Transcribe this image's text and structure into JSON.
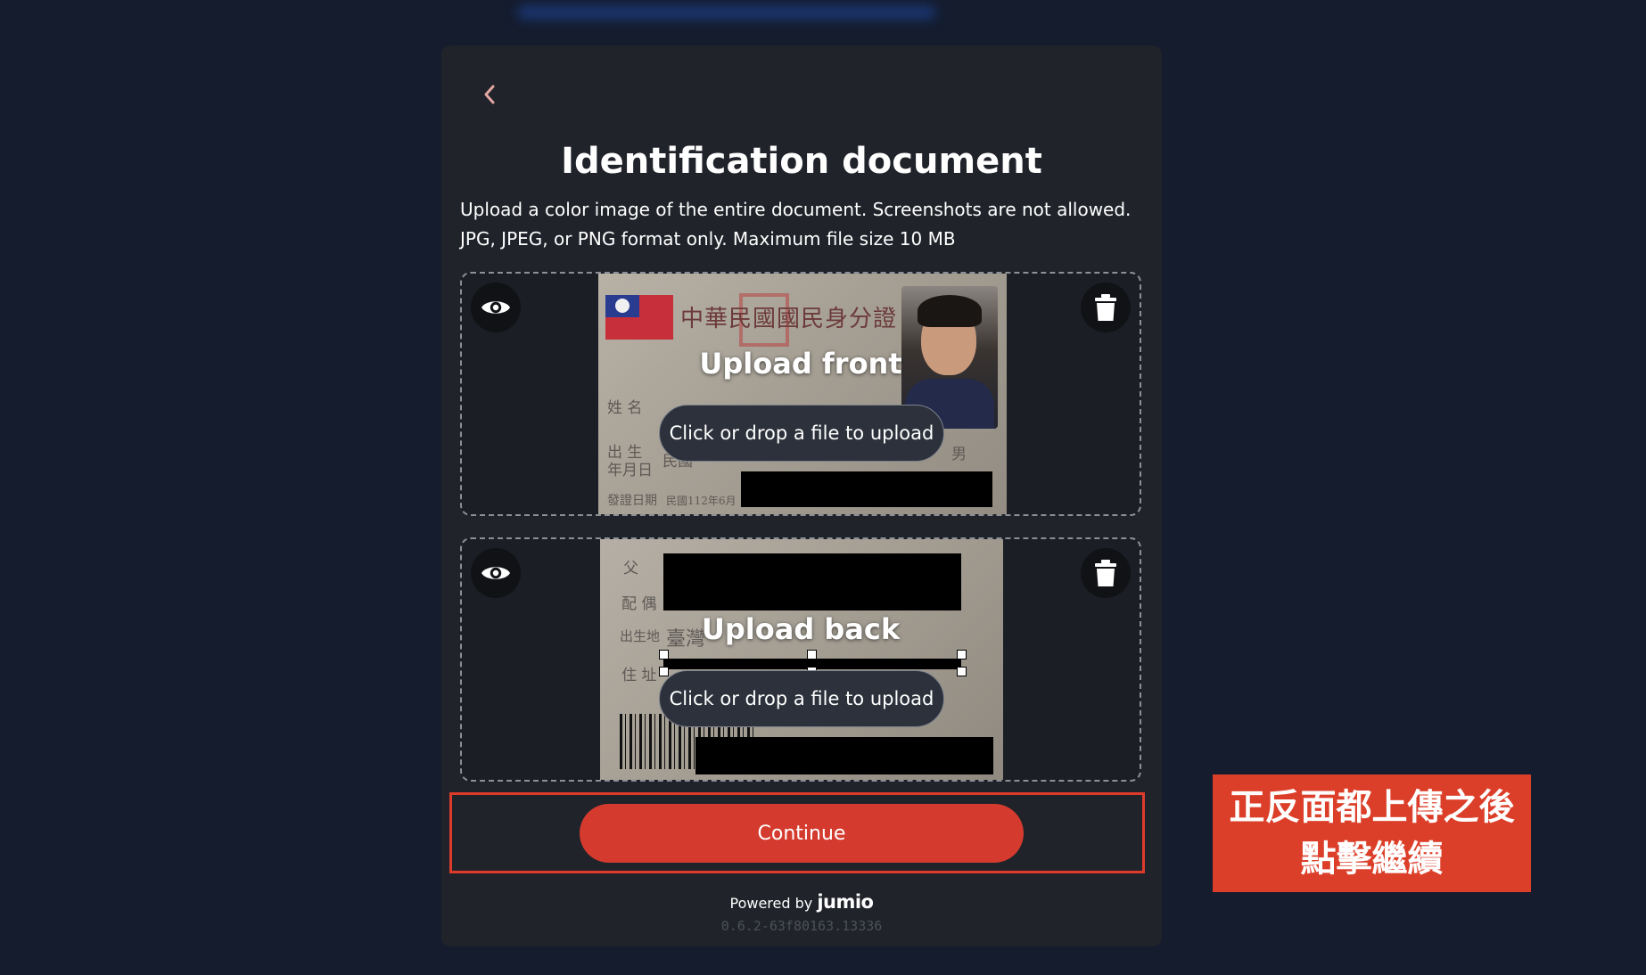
{
  "header": {
    "title": "Identification document",
    "description_line1": "Upload a color image of the entire document. Screenshots are not allowed.",
    "description_line2": "JPG, JPEG, or PNG format only. Maximum file size 10 MB"
  },
  "front": {
    "title": "Upload front",
    "button_label": "Click or drop a file to upload",
    "card_header": "中華民國國民身分證",
    "card_field_name": "姓 名",
    "card_field_birth_a": "出 生",
    "card_field_birth_b": "年月日",
    "card_field_birth_value": "民國",
    "card_field_issue": "發證日期",
    "card_field_issue_value": "民國112年6月",
    "card_field_sex": "男"
  },
  "back": {
    "title": "Upload back",
    "button_label": "Click or drop a file to upload",
    "card_field_father": "父",
    "card_field_spouse": "配 偶",
    "card_field_birthplace": "出生地",
    "card_field_birthplace_value": "臺灣",
    "card_field_address": "住 址"
  },
  "icons": {
    "preview": "eye-icon",
    "delete": "trash-icon",
    "back": "chevron-left-icon"
  },
  "actions": {
    "continue_label": "Continue"
  },
  "footer": {
    "powered_prefix": "Powered by",
    "brand": "jumio",
    "version": "0.6.2-63f80163.13336"
  },
  "annotation": {
    "line1": "正反面都上傳之後",
    "line2": "點擊繼續"
  },
  "colors": {
    "page_bg": "#141c2e",
    "panel_bg": "#20232a",
    "accent": "#d43b2e",
    "annotation_bg": "#dc3f29"
  }
}
